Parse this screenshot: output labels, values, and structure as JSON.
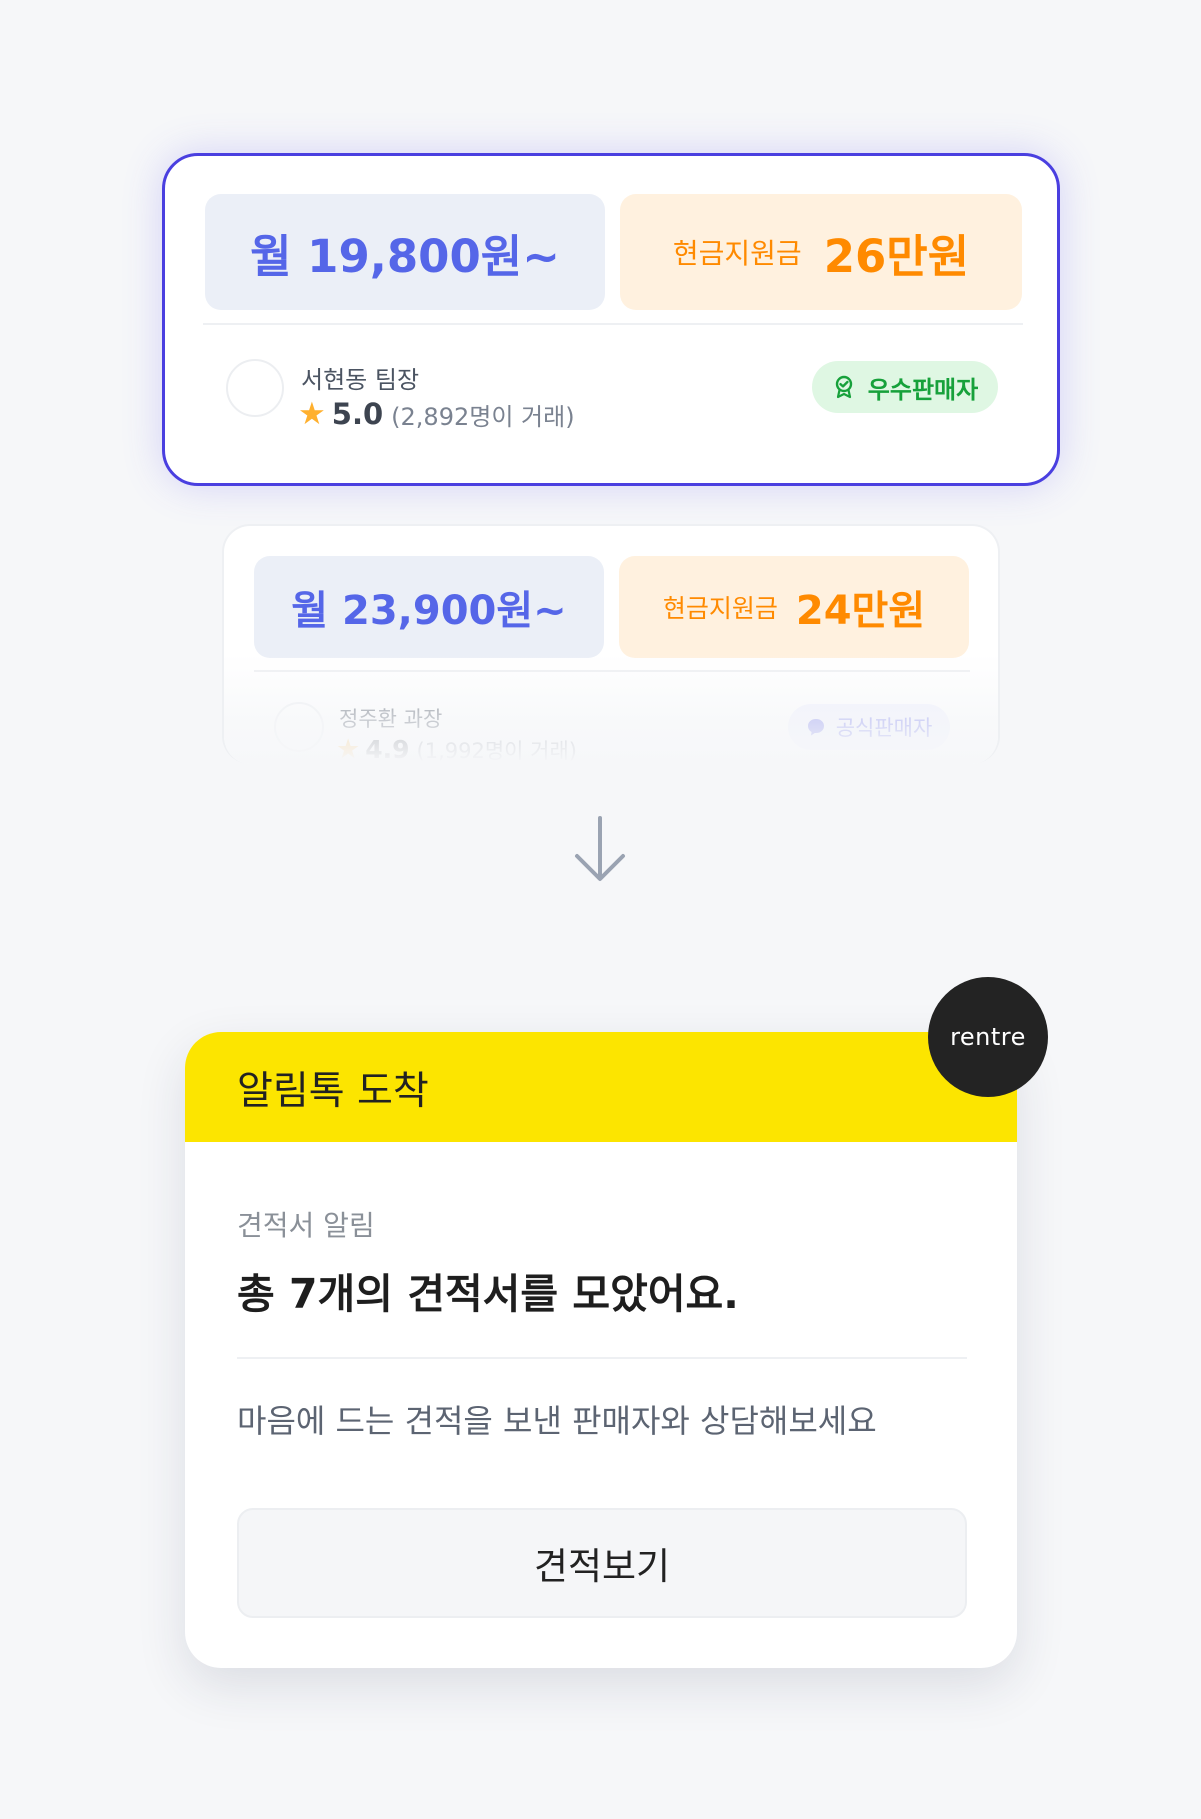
{
  "quotes": [
    {
      "monthly_price": "월 19,800원~",
      "cash_label": "현금지원금",
      "cash_value": "26만원",
      "seller_name": "서현동 팀장",
      "rating_score": "5.0",
      "rating_count": "(2,892명이 거래)",
      "badge": "우수판매자",
      "badge_icon": "award-ribbon-icon"
    },
    {
      "monthly_price": "월 23,900원~",
      "cash_label": "현금지원금",
      "cash_value": "24만원",
      "seller_name": "정주환 과장",
      "rating_score": "4.9",
      "rating_count": "(1,992명이 거래)",
      "badge": "공식판매자",
      "badge_icon": "chat-bubble-icon"
    }
  ],
  "notification": {
    "header_title": "알림톡 도착",
    "subtitle": "견적서 알림",
    "title": "총 7개의 견적서를 모았어요.",
    "body": "마음에 드는 견적을 보낸 판매자와 상담해보세요",
    "button_label": "견적보기"
  },
  "brand": {
    "logo_text": "rentre",
    "header_color": "#fce500",
    "accent_color": "#4a3fe0",
    "price_color": "#5566e8",
    "cash_color": "#ff8a00"
  }
}
